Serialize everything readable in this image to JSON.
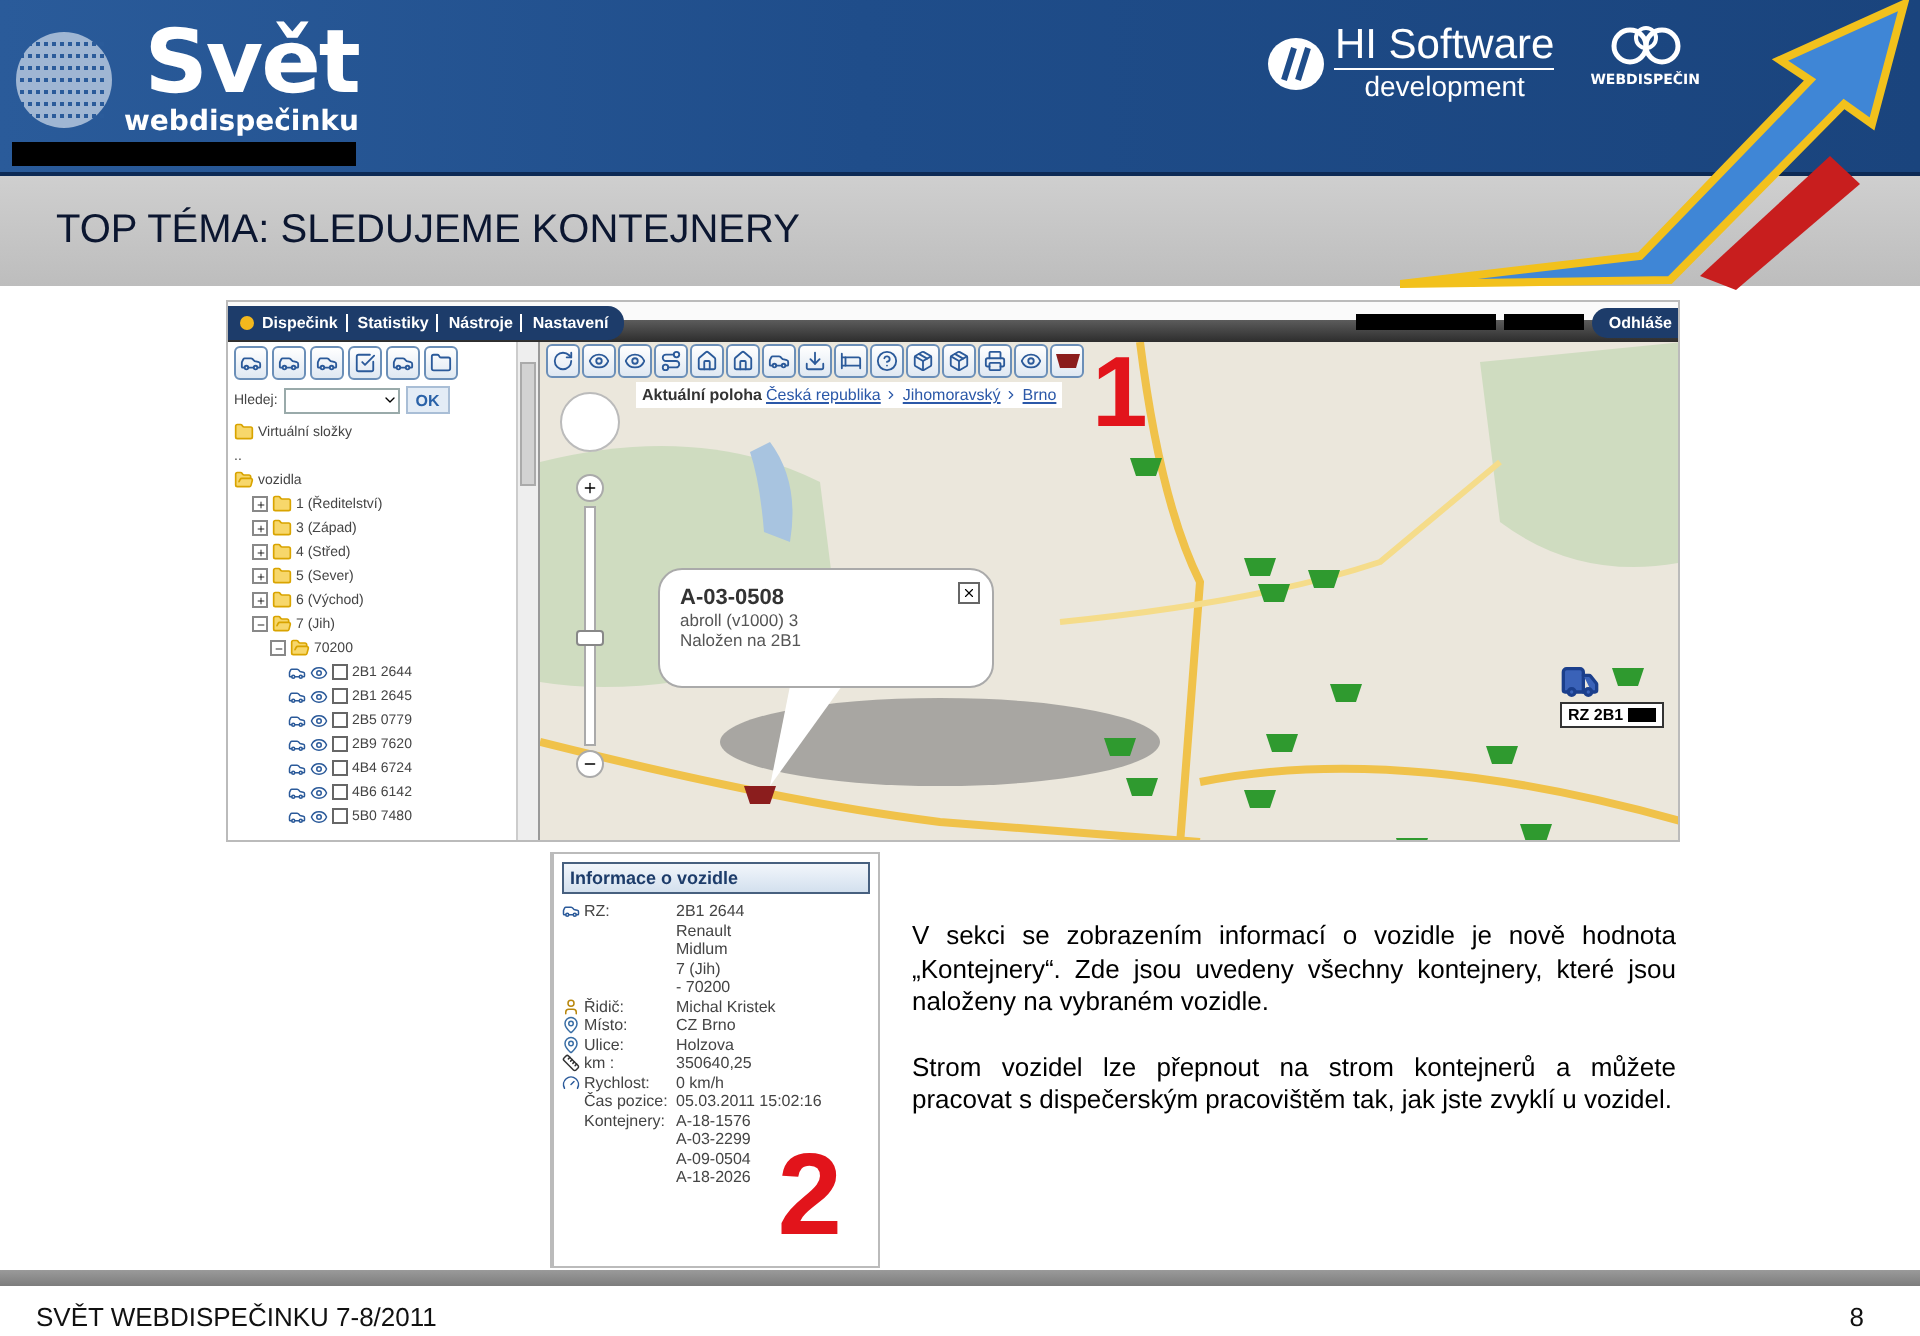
{
  "header": {
    "logo_title": "Svět",
    "logo_subtitle": "webdispečinku",
    "partner": "HI Software",
    "partner_sub": "development",
    "brand": "WEBDISPEČIN"
  },
  "title": "TOP TÉMA: SLEDUJEME KONTEJNERY",
  "app": {
    "nav": [
      "Dispečink",
      "Statistiky",
      "Nástroje",
      "Nastavení"
    ],
    "logout": "Odhláše",
    "search_label": "Hledej:",
    "search_button": "OK",
    "tree": [
      {
        "label": "Virtuální složky",
        "kind": "virtual"
      },
      {
        "label": "..",
        "kind": "parent"
      },
      {
        "label": "vozidla",
        "kind": "folder",
        "expanded": true,
        "children": [
          {
            "label": "1 (Ředitelství)",
            "kind": "folder",
            "expanded": false
          },
          {
            "label": "3 (Západ)",
            "kind": "folder",
            "expanded": false
          },
          {
            "label": "4 (Střed)",
            "kind": "folder",
            "expanded": false
          },
          {
            "label": "5 (Sever)",
            "kind": "folder",
            "expanded": false
          },
          {
            "label": "6 (Východ)",
            "kind": "folder",
            "expanded": false
          },
          {
            "label": "7 (Jih)",
            "kind": "folder",
            "expanded": true,
            "children": [
              {
                "label": "70200",
                "kind": "folder",
                "expanded": true,
                "children": [
                  {
                    "label": "2B1 2644",
                    "kind": "vehicle",
                    "checked": false
                  },
                  {
                    "label": "2B1 2645",
                    "kind": "vehicle",
                    "checked": false
                  },
                  {
                    "label": "2B5 0779",
                    "kind": "vehicle",
                    "checked": false
                  },
                  {
                    "label": "2B9 7620",
                    "kind": "vehicle",
                    "checked": false
                  },
                  {
                    "label": "4B4 6724",
                    "kind": "vehicle",
                    "checked": false
                  },
                  {
                    "label": "4B6 6142",
                    "kind": "vehicle",
                    "checked": false
                  },
                  {
                    "label": "5B0 7480",
                    "kind": "vehicle",
                    "checked": false
                  }
                ]
              }
            ]
          }
        ]
      }
    ],
    "breadcrumb": {
      "label": "Aktuální poloha",
      "links": [
        "Česká republika",
        "Jihomoravský",
        "Brno"
      ]
    },
    "zoom_slider": {
      "level": 0.44
    },
    "popup": {
      "title": "A-03-0508",
      "lines": [
        "abroll (v1000) 3",
        "Naložen na 2B1"
      ]
    },
    "vehicle_label": "RZ 2B1",
    "callout": "1"
  },
  "info": {
    "title": "Informace o vozidle",
    "rows": [
      {
        "kind": "vehicle",
        "label": "RZ:",
        "values": [
          "2B1 2644",
          "Renault",
          "Midlum",
          "7 (Jih)",
          "- 70200"
        ]
      },
      {
        "kind": "driver",
        "label": "Řidič:",
        "values": [
          "Michal Kristek"
        ]
      },
      {
        "kind": "place",
        "label": "Místo:",
        "values": [
          "CZ Brno"
        ]
      },
      {
        "kind": "place",
        "label": "Ulice:",
        "values": [
          "Holzova"
        ]
      },
      {
        "kind": "distance",
        "label": "km :",
        "values": [
          "350640,25"
        ]
      },
      {
        "kind": "speed",
        "label": "Rychlost:",
        "values": [
          "0 km/h"
        ]
      },
      {
        "kind": "plain",
        "label": "Čas pozice:",
        "values": [
          "05.03.2011 15:02:16"
        ]
      },
      {
        "kind": "plain",
        "label": "Kontejnery:",
        "values": [
          "A-18-1576",
          "A-03-2299",
          "A-09-0504",
          "A-18-2026"
        ]
      }
    ],
    "callout": "2"
  },
  "paragraphs": [
    "V sekci se zobrazením informací o vozidle je nově hodnota „Kontejnery“. Zde jsou uvedeny všechny kontejnery, které jsou naloženy na vybraném vozidle.",
    "Strom vozidel lze přepnout na strom kontejnerů a můžete pracovat s dispečerským pracovištěm tak, jak jste zvyklí u vozidel."
  ],
  "footer": {
    "text": "SVĚT WEBDISPEČINKU 7-8/2011",
    "page": "8"
  }
}
